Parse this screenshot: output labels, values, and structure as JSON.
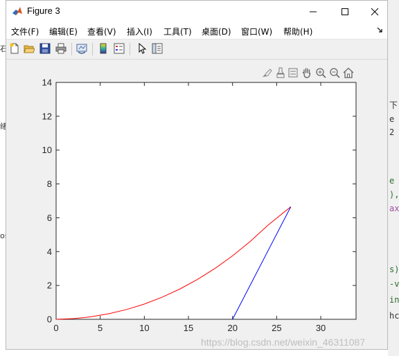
{
  "window": {
    "title": "Figure 3"
  },
  "menu": {
    "items": [
      {
        "label": "文件(F)"
      },
      {
        "label": "编辑(E)"
      },
      {
        "label": "查看(V)"
      },
      {
        "label": "插入(I)"
      },
      {
        "label": "工具(T)"
      },
      {
        "label": "桌面(D)"
      },
      {
        "label": "窗口(W)"
      },
      {
        "label": "帮助(H)"
      }
    ]
  },
  "toolbar": {
    "buttons": [
      "new-figure-icon",
      "open-folder-icon",
      "save-icon",
      "print-icon",
      "link-plot-icon",
      "colorbar-icon",
      "legend-icon",
      "pointer-icon",
      "property-inspector-icon"
    ]
  },
  "axes_toolbar": {
    "buttons": [
      "brush-icon",
      "data-tips-icon",
      "rotate-icon",
      "pan-icon",
      "zoom-in-icon",
      "zoom-out-icon",
      "home-icon"
    ]
  },
  "chart_data": {
    "type": "line",
    "xlim": [
      0,
      34
    ],
    "ylim": [
      0,
      14
    ],
    "xticks": [
      0,
      5,
      10,
      15,
      20,
      25,
      30
    ],
    "yticks": [
      0,
      2,
      4,
      6,
      8,
      10,
      12,
      14
    ],
    "series": [
      {
        "color": "#ff0000",
        "x": [
          0,
          2,
          4,
          6,
          8,
          10,
          12,
          14,
          16,
          18,
          20,
          22,
          24,
          26,
          26.6
        ],
        "y": [
          0,
          0.04,
          0.15,
          0.33,
          0.58,
          0.9,
          1.3,
          1.78,
          2.35,
          3.0,
          3.75,
          4.6,
          5.55,
          6.4,
          6.65
        ]
      },
      {
        "color": "#0000ff",
        "x": [
          20.0,
          26.6
        ],
        "y": [
          0.0,
          6.65
        ]
      }
    ]
  },
  "watermark": "https://blog.csdn.net/weixin_46311087",
  "background_fragments": {
    "right": [
      "下",
      "e",
      "2",
      "e",
      "),",
      "ax",
      "s)",
      "-v",
      "in",
      "hc"
    ],
    "left": [
      "石",
      "绪",
      "os"
    ]
  }
}
